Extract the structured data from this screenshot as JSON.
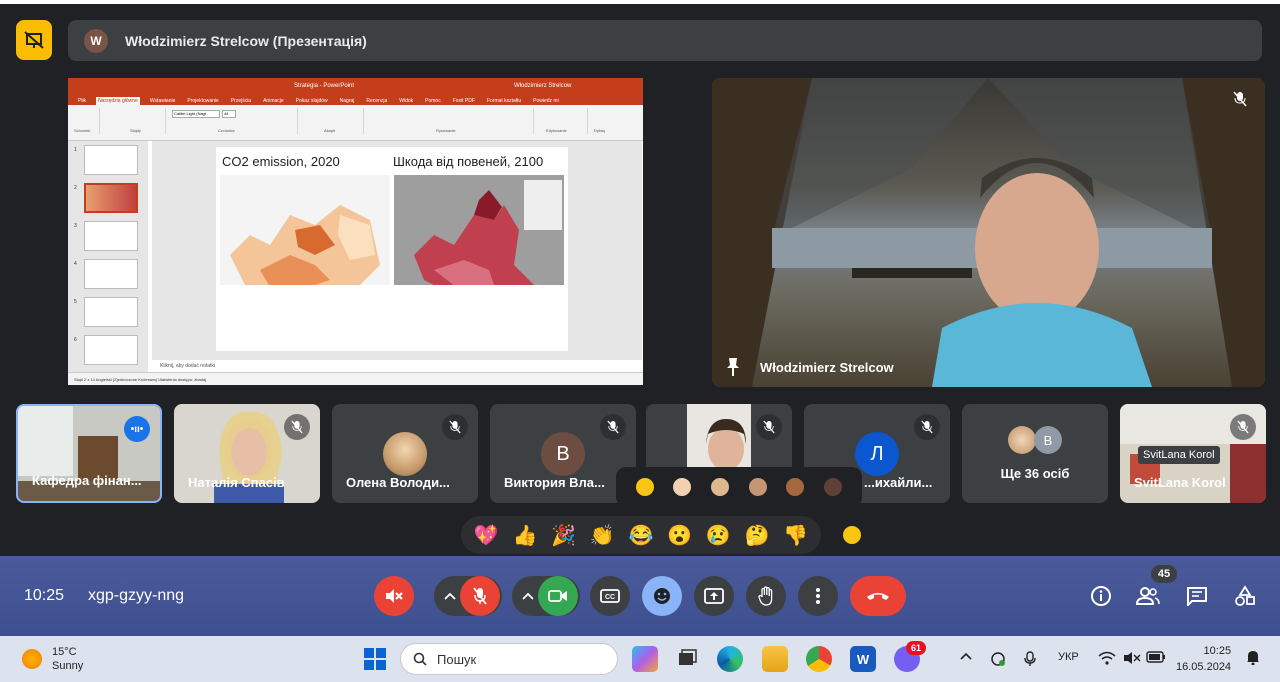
{
  "presentation_bar": {
    "avatar_letter": "W",
    "title": "Włodzimierz Strelcow (Презентація)"
  },
  "ppt": {
    "window_title": "Strategia - PowerPoint",
    "user": "Włodzimierz Strelcow",
    "tabs": [
      "Plik",
      "Narzędzia główne",
      "Wstawianie",
      "Projektowanie",
      "Przejścia",
      "Animacje",
      "Pokaz slajdów",
      "Nagraj",
      "Recenzja",
      "Widok",
      "Pomoc",
      "Foxit PDF",
      "Format kształtu",
      "Powiedz mi"
    ],
    "ribbon_groups": [
      "Schowek",
      "Slajdy",
      "Czcionka",
      "Akapit",
      "Rysowanie",
      "Edytowanie",
      "Dyktuj"
    ],
    "font": "Calibri Light (Nagł",
    "font_size": "44",
    "slide_title_left": "CO2 emission, 2020",
    "slide_title_right": "Шкода від повеней, 2100",
    "notes": "Kliknij, aby dodać notatki",
    "status": "Slajd 2 z 14   Angielski (Zjednoczone Królestwo)   Ułatwienia dostępu: zbadaj"
  },
  "main_video": {
    "name": "Włodzimierz Strelcow"
  },
  "tiles": [
    {
      "name": "Кафедра фінан...",
      "type": "video"
    },
    {
      "name": "Наталія Спасів",
      "type": "video"
    },
    {
      "name": "Олена Володи...",
      "type": "avatar"
    },
    {
      "name": "Виктория Вла...",
      "type": "letter",
      "letter": "В"
    },
    {
      "name": "",
      "type": "video"
    },
    {
      "name": "...ихайли...",
      "type": "letter",
      "letter": "Л"
    },
    {
      "name": "Ще 36 осіб",
      "type": "more",
      "letter": "В"
    },
    {
      "name": "SvitLana Korol",
      "type": "video",
      "tooltip": "SvitLana Korol"
    }
  ],
  "emojis": [
    "💖",
    "👍",
    "🎉",
    "👏",
    "😂",
    "😮",
    "😢",
    "🤔",
    "👎"
  ],
  "skin_tones": [
    "#f9c513",
    "#f2d1b1",
    "#e0b88f",
    "#c69574",
    "#a6673f",
    "#5e4034"
  ],
  "toolbar": {
    "time": "10:25",
    "meeting_code": "xgp-gzyy-nng",
    "participants_count": "45"
  },
  "taskbar": {
    "temperature": "15°C",
    "weather": "Sunny",
    "search": "Пошук",
    "lang": "УКР",
    "clock_time": "10:25",
    "clock_date": "16.05.2024",
    "viber_badge": "61"
  }
}
